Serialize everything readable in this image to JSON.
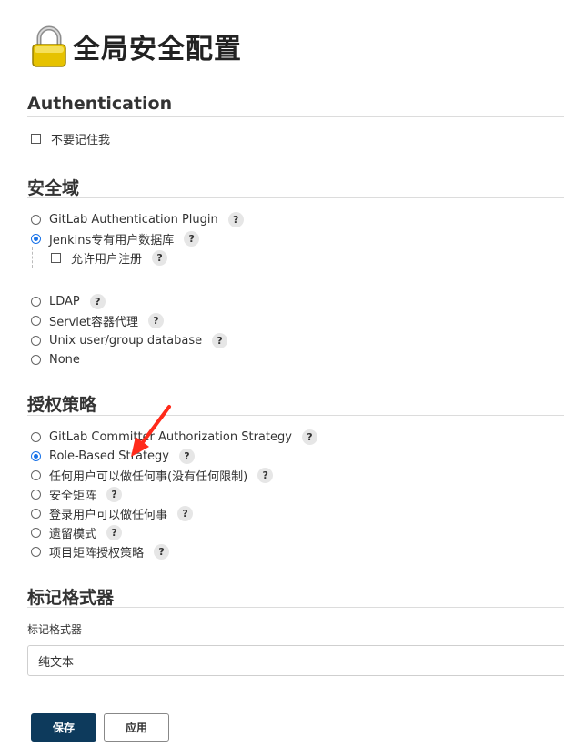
{
  "header": {
    "title": "全局安全配置",
    "icon": "lock-icon"
  },
  "authentication": {
    "heading": "Authentication",
    "remember_me_label": "不要记住我"
  },
  "security_realm": {
    "heading": "安全域",
    "options": [
      {
        "label": "GitLab Authentication Plugin",
        "selected": false
      },
      {
        "label": "Jenkins专有用户数据库",
        "selected": true
      },
      {
        "label": "LDAP",
        "selected": false
      },
      {
        "label": "Servlet容器代理",
        "selected": false
      },
      {
        "label": "Unix user/group database",
        "selected": false
      },
      {
        "label": "None",
        "selected": false
      }
    ],
    "allow_signup_label": "允许用户注册"
  },
  "authorization": {
    "heading": "授权策略",
    "options": [
      {
        "label": "GitLab Committer Authorization Strategy",
        "selected": false
      },
      {
        "label": "Role-Based Strategy",
        "selected": true
      },
      {
        "label": "任何用户可以做任何事(没有任何限制)",
        "selected": false
      },
      {
        "label": "安全矩阵",
        "selected": false
      },
      {
        "label": "登录用户可以做任何事",
        "selected": false
      },
      {
        "label": "遗留模式",
        "selected": false
      },
      {
        "label": "项目矩阵授权策略",
        "selected": false
      }
    ]
  },
  "markup_formatter": {
    "heading": "标记格式器",
    "field_label": "标记格式器",
    "selected_value": "纯文本"
  },
  "buttons": {
    "save": "保存",
    "apply": "应用"
  },
  "help_symbol": "?",
  "colors": {
    "accent": "#1a73e8",
    "save_button": "#0d3a5c",
    "annotation_arrow": "#ff2a1a"
  }
}
